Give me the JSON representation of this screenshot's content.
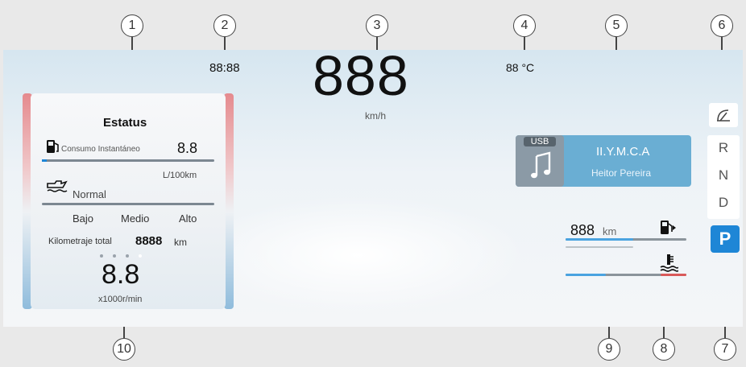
{
  "callouts": [
    "1",
    "2",
    "3",
    "4",
    "5",
    "6",
    "7",
    "8",
    "9",
    "10"
  ],
  "top": {
    "clock": "88:88",
    "speed": "888",
    "speed_unit": "km/h",
    "temperature": "88 °C"
  },
  "status_card": {
    "title": "Estatus",
    "fuel_label": "Consumo Instantáneo",
    "fuel_value": "8.8",
    "fuel_unit": "L/100km",
    "drive_mode": "Normal",
    "levels": [
      "Bajo",
      "Medio",
      "Alto"
    ],
    "odometer_label": "Kilometraje total",
    "odometer_value": "8888",
    "odometer_unit": "km",
    "rpm_value": "8.8",
    "rpm_unit": "x1000r/min"
  },
  "media": {
    "source": "USB",
    "title": "II.Y.M.C.A",
    "artist": "Heitor Pereira"
  },
  "range": {
    "value": "888",
    "unit": "km"
  },
  "gears": [
    "R",
    "N",
    "D"
  ],
  "park": "P",
  "icons": [
    "fuel-pump-icon",
    "oil-can-icon",
    "music-note-icon",
    "coolant-temp-icon",
    "wiper-icon"
  ]
}
